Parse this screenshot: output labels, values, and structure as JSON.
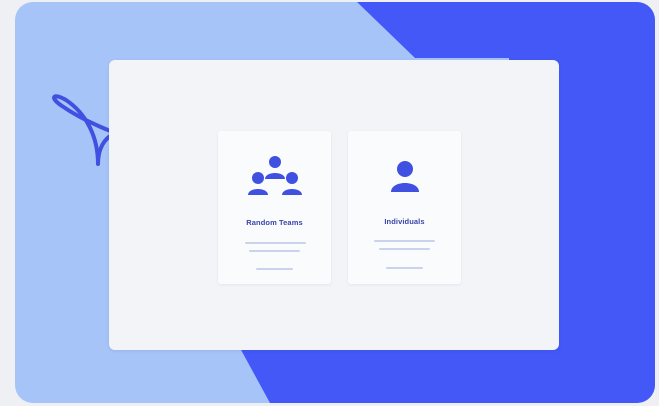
{
  "colors": {
    "light_blue": "#a6c4f7",
    "royal_blue": "#4358f7",
    "icon_blue": "#4050e0",
    "label_blue": "#3a44a8",
    "placeholder_line": "#c9d4ec",
    "panel": "#f3f4f8"
  },
  "options": [
    {
      "label": "Random Teams",
      "icon": "team-group-icon"
    },
    {
      "label": "Individuals",
      "icon": "single-person-icon"
    }
  ]
}
